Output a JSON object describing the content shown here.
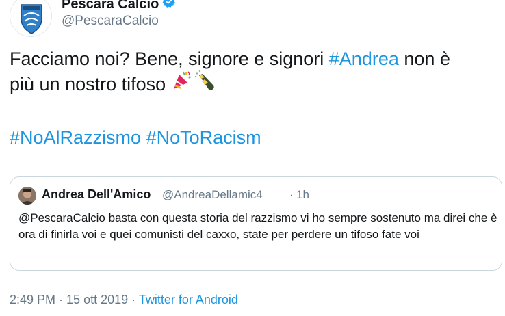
{
  "author": {
    "display_name": "Pescara Calcio",
    "handle": "@PescaraCalcio",
    "verified": true,
    "brand_color": "#1b95e0"
  },
  "tweet": {
    "text_part1": "Facciamo noi? Bene, signore e signori ",
    "mention_hashtag": "#Andrea",
    "text_part2": " non è",
    "text_line2": "più un nostro tifoso ",
    "emojis": [
      "party-popper-icon",
      "champagne-icon"
    ],
    "hashtags": [
      "#NoAlRazzismo",
      "#NoToRacism"
    ]
  },
  "quoted_tweet": {
    "display_name": "Andrea Dell'Amico",
    "handle": "@AndreaDellamic4",
    "separator": "·",
    "time": "1h",
    "text": "@PescaraCalcio basta con questa storia del razzismo vi ho sempre sostenuto ma direi che è ora di finirla voi e quei comunisti del caxxo, state per perdere un tifoso fate voi"
  },
  "meta": {
    "time": "2:49 PM",
    "separator1": " · ",
    "date": "15 ott 2019",
    "separator2": " · ",
    "source": "Twitter for Android"
  }
}
